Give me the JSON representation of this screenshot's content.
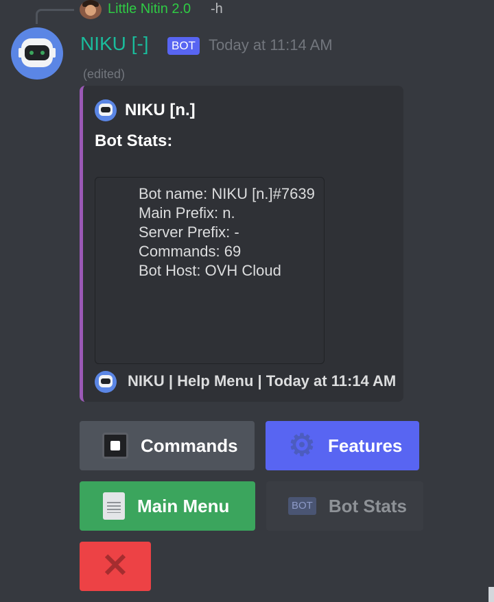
{
  "reply": {
    "author": "Little Nitin 2.0",
    "content": "-h"
  },
  "message": {
    "author": "NIKU [-]",
    "tag": "BOT",
    "timestamp": "Today at 11:14 AM",
    "edited": "(edited)"
  },
  "embed": {
    "color": "#9b59b6",
    "author": "NIKU [n.]",
    "title": "Bot Stats:",
    "lines": [
      "Bot name: NIKU [n.]#7639",
      "Main Prefix: n.",
      "Server Prefix: -",
      "Commands: 69",
      "Bot Host: OVH Cloud"
    ],
    "footer": "NIKU | Help Menu | Today at 11:14 AM"
  },
  "buttons": {
    "commands": {
      "label": "Commands",
      "icon": "terminal-icon",
      "color": "#4f545c"
    },
    "features": {
      "label": "Features",
      "icon": "gear-icon",
      "color": "#5865f2"
    },
    "main_menu": {
      "label": "Main Menu",
      "icon": "document-icon",
      "color": "#3ba55d"
    },
    "bot_stats": {
      "label": "Bot Stats",
      "icon_text": "BOT",
      "disabled": true
    },
    "close": {
      "icon": "x-icon",
      "color": "#ed4245"
    }
  }
}
